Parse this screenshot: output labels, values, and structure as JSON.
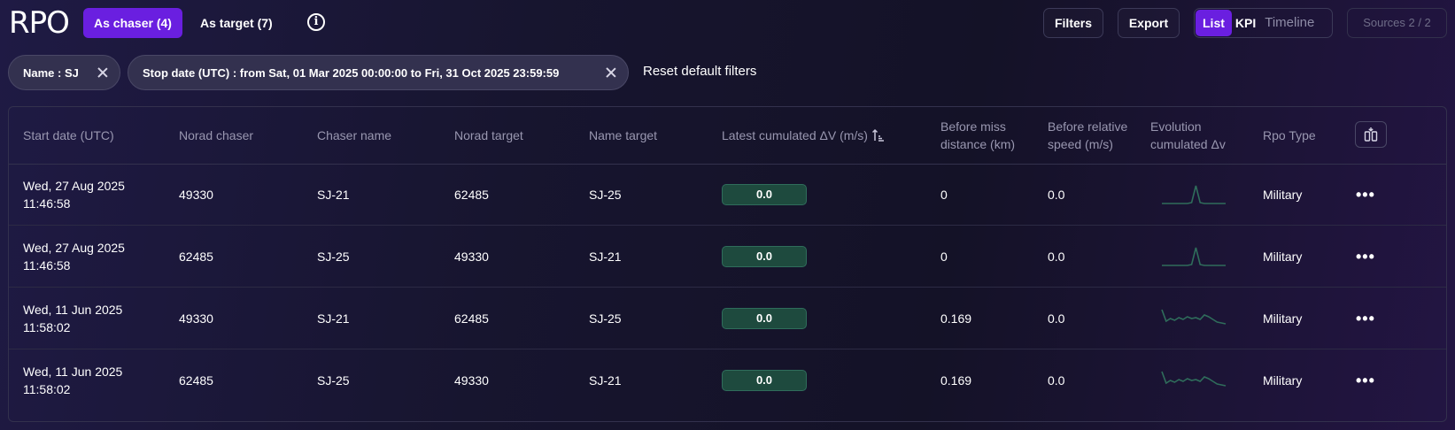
{
  "logo": "RPO",
  "mode_tabs": [
    {
      "label": "As chaser (4)",
      "active": true
    },
    {
      "label": "As target (7)",
      "active": false
    }
  ],
  "toolbar": {
    "filters_label": "Filters",
    "export_label": "Export",
    "views": [
      "List",
      "KPI",
      "Timeline"
    ],
    "active_view": "List",
    "sources_label": "Sources 2 / 2"
  },
  "filters": {
    "chips": [
      {
        "label": "Name : SJ"
      },
      {
        "label": "Stop date (UTC) : from Sat, 01 Mar 2025 00:00:00 to Fri, 31 Oct 2025 23:59:59"
      }
    ],
    "reset_label": "Reset default filters"
  },
  "table": {
    "columns": [
      {
        "key": "start",
        "label": "Start date (UTC)"
      },
      {
        "key": "norad_chaser",
        "label": "Norad chaser"
      },
      {
        "key": "chaser_name",
        "label": "Chaser name"
      },
      {
        "key": "norad_target",
        "label": "Norad target"
      },
      {
        "key": "name_target",
        "label": "Name target"
      },
      {
        "key": "dv",
        "label": "Latest cumulated ΔV (m/s)",
        "sorted": "ascending"
      },
      {
        "key": "miss",
        "label": "Before miss distance (km)"
      },
      {
        "key": "speed",
        "label": "Before relative speed (m/s)"
      },
      {
        "key": "evolution",
        "label": "Evolution cumulated Δv"
      },
      {
        "key": "rpo_type",
        "label": "Rpo Type"
      }
    ],
    "rows": [
      {
        "start": "Wed, 27 Aug 2025 11:46:58",
        "norad_chaser": "49330",
        "chaser_name": "SJ-21",
        "norad_target": "62485",
        "name_target": "SJ-25",
        "dv": "0.0",
        "miss": "0",
        "speed": "0.0",
        "evolution": [
          0,
          0,
          0,
          0,
          0,
          0,
          0,
          0.05,
          1,
          0.05,
          0,
          0,
          0,
          0,
          0,
          0
        ],
        "rpo_type": "Military"
      },
      {
        "start": "Wed, 27 Aug 2025 11:46:58",
        "norad_chaser": "62485",
        "chaser_name": "SJ-25",
        "norad_target": "49330",
        "name_target": "SJ-21",
        "dv": "0.0",
        "miss": "0",
        "speed": "0.0",
        "evolution": [
          0,
          0,
          0,
          0,
          0,
          0,
          0,
          0.05,
          1,
          0.05,
          0,
          0,
          0,
          0,
          0,
          0
        ],
        "rpo_type": "Military"
      },
      {
        "start": "Wed, 11 Jun 2025 11:58:02",
        "norad_chaser": "49330",
        "chaser_name": "SJ-21",
        "norad_target": "62485",
        "name_target": "SJ-25",
        "dv": "0.0",
        "miss": "0.169",
        "speed": "0.0",
        "evolution": [
          1,
          0.35,
          0.5,
          0.4,
          0.55,
          0.45,
          0.6,
          0.5,
          0.55,
          0.45,
          0.7,
          0.6,
          0.45,
          0.3,
          0.25,
          0.2
        ],
        "rpo_type": "Military"
      },
      {
        "start": "Wed, 11 Jun 2025 11:58:02",
        "norad_chaser": "62485",
        "chaser_name": "SJ-25",
        "norad_target": "49330",
        "name_target": "SJ-21",
        "dv": "0.0",
        "miss": "0.169",
        "speed": "0.0",
        "evolution": [
          1,
          0.35,
          0.5,
          0.4,
          0.55,
          0.45,
          0.6,
          0.5,
          0.55,
          0.45,
          0.7,
          0.6,
          0.45,
          0.3,
          0.25,
          0.2
        ],
        "rpo_type": "Military"
      }
    ]
  },
  "colors": {
    "accent": "#6a1fe0",
    "badge_bg": "#1e4a3e",
    "sparkline": "#2f6d5b"
  },
  "icons": {
    "info": "info-icon",
    "chip_close": "close-icon",
    "sort": "sort-ascending-icon",
    "columns": "columns-icon",
    "row_menu": "more-horizontal-icon"
  }
}
